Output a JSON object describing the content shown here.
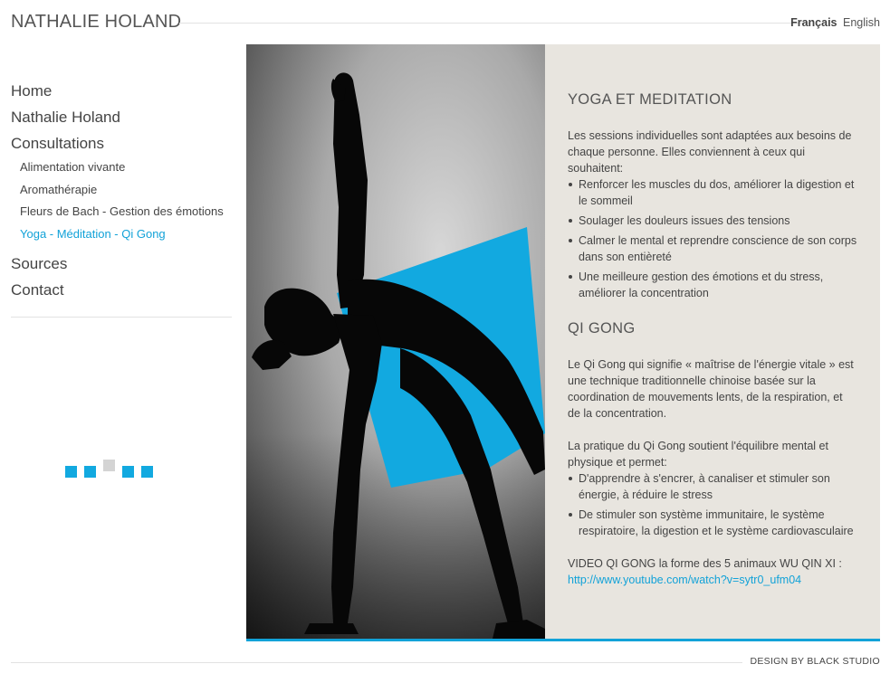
{
  "header": {
    "title": "NATHALIE HOLAND",
    "languages": [
      "Français",
      "English"
    ]
  },
  "nav": {
    "items": [
      {
        "label": "Home"
      },
      {
        "label": "Nathalie Holand"
      },
      {
        "label": "Consultations"
      },
      {
        "label": "Alimentation vivante"
      },
      {
        "label": "Aromathérapie"
      },
      {
        "label": "Fleurs de Bach - Gestion des émotions"
      },
      {
        "label": "Yoga - Méditation - Qi Gong"
      },
      {
        "label": "Sources"
      },
      {
        "label": "Contact"
      }
    ]
  },
  "slider": {
    "dots": 5,
    "active_index": 2
  },
  "content": {
    "yoga_title": "YOGA  ET MEDITATION",
    "yoga_intro": "Les sessions individuelles sont adaptées aux besoins de chaque personne. Elles conviennent à ceux qui souhaitent:",
    "yoga_list": [
      "Renforcer les muscles du dos, améliorer la digestion et le sommeil",
      "Soulager les douleurs issues des tensions",
      "Calmer le mental et reprendre conscience de son corps dans son entièreté",
      "Une meilleure gestion des émotions et du stress, améliorer la concentration"
    ],
    "qigong_title": "QI GONG",
    "qigong_p1": "Le Qi Gong qui signifie « maîtrise de l'énergie vitale » est une technique traditionnelle chinoise basée sur la coordination de mouvements lents, de la respiration, et de la concentration.",
    "qigong_p2": "La pratique du Qi Gong soutient l'équilibre mental et physique et permet:",
    "qigong_list": [
      "D'apprendre à s'encrer, à canaliser et stimuler son énergie, à réduire le stress",
      "De stimuler son système immunitaire, le système respiratoire, la digestion et le système cardiovasculaire"
    ],
    "video_text": "VIDEO QI GONG la forme des 5 animaux WU QIN XI :",
    "video_link": "http://www.youtube.com/watch?v=sytr0_ufm04"
  },
  "footer": {
    "credit": "DESIGN BY BLACK STUDIO"
  },
  "colors": {
    "accent": "#12a2d8",
    "panel_bg": "#e8e5df"
  }
}
